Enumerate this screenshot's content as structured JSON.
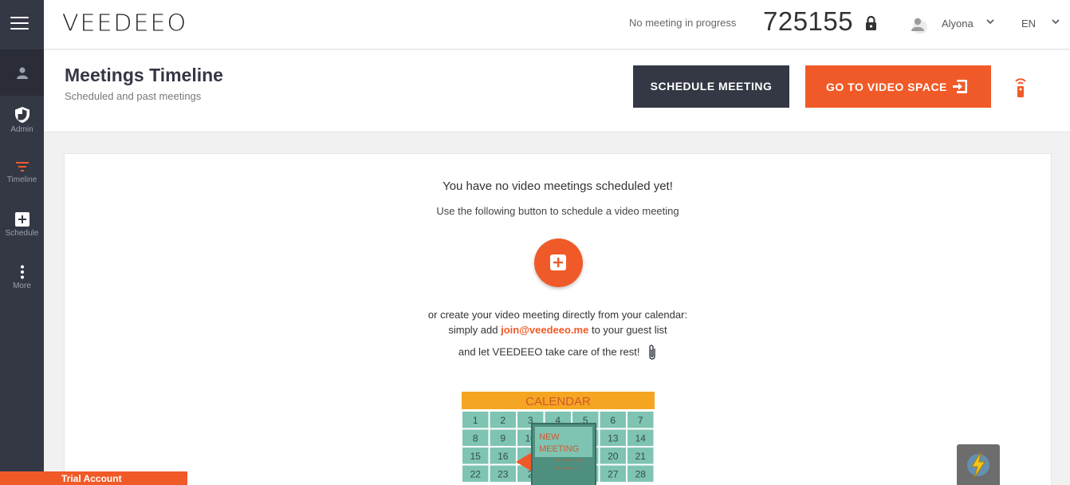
{
  "app": {
    "logo": "VEEDEEO"
  },
  "topbar": {
    "meeting_status": "No meeting in progress",
    "room_number": "725155",
    "user_name": "Alyona",
    "language": "EN"
  },
  "sidebar": {
    "items": [
      {
        "label": "Admin",
        "icon": "shield-icon"
      },
      {
        "label": "Timeline",
        "icon": "filter-icon"
      },
      {
        "label": "Schedule",
        "icon": "plus-box-icon"
      },
      {
        "label": "More",
        "icon": "more-vertical-icon"
      }
    ]
  },
  "header": {
    "title": "Meetings Timeline",
    "subtitle": "Scheduled and past meetings",
    "schedule_label": "SCHEDULE MEETING",
    "video_label": "GO TO VIDEO SPACE"
  },
  "empty_state": {
    "title": "You have no video meetings scheduled yet!",
    "subtitle": "Use the following button to schedule a video meeting",
    "line1": "or create your video meeting directly from your calendar:",
    "line2_prefix": "simply add",
    "email": "join@veedeeo.me",
    "line2_suffix": "to your guest list",
    "line3": "and let VEEDEEO take care of the rest!"
  },
  "calendar": {
    "header": "CALENDAR",
    "note": [
      "NEW",
      "MEETING"
    ],
    "rows": [
      [
        "1",
        "2",
        "3",
        "4",
        "5",
        "6",
        "7"
      ],
      [
        "8",
        "9",
        "10",
        "",
        "",
        "13",
        "14"
      ],
      [
        "15",
        "16",
        "",
        "",
        "",
        "20",
        "21"
      ],
      [
        "22",
        "23",
        "2",
        "",
        "",
        "27",
        "28"
      ]
    ]
  },
  "footer": {
    "trial_label": "Trial Account"
  },
  "colors": {
    "accent": "#f05a28",
    "dark": "#343845",
    "calendar_cell": "#7fc4b3",
    "calendar_header": "#f4a623"
  }
}
